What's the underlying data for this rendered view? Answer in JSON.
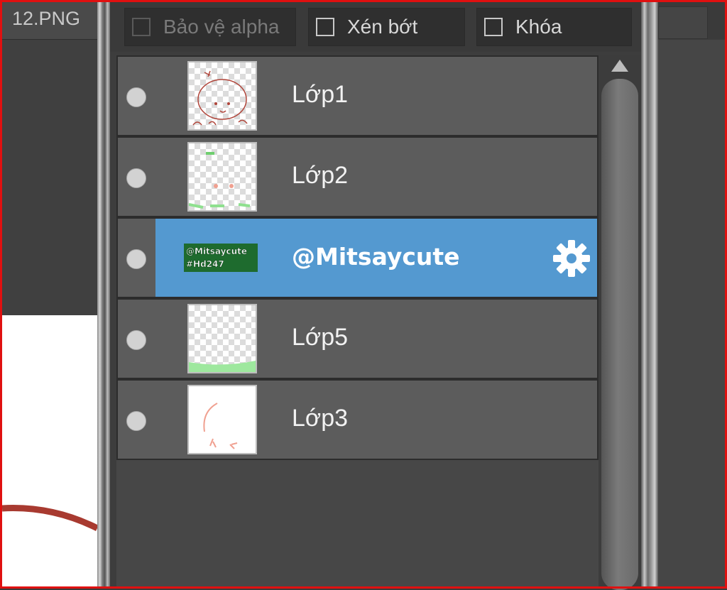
{
  "document_tab": {
    "label": "12.PNG"
  },
  "options": {
    "protect_alpha": {
      "label": "Bảo vệ alpha",
      "checked": false,
      "enabled": false
    },
    "clipping": {
      "label": "Xén bớt",
      "checked": false,
      "enabled": true
    },
    "lock": {
      "label": "Khóa",
      "checked": false,
      "enabled": true
    }
  },
  "layers": [
    {
      "name": "Lớp1",
      "visible": true,
      "selected": false
    },
    {
      "name": "Lớp2",
      "visible": true,
      "selected": false
    },
    {
      "name": "@Mitsaycute",
      "visible": true,
      "selected": true,
      "thumb_text": [
        "@Mitsaycute",
        "#Hd247"
      ]
    },
    {
      "name": "Lớp5",
      "visible": true,
      "selected": false
    },
    {
      "name": "Lớp3",
      "visible": true,
      "selected": false
    }
  ],
  "icons": {
    "gear": "gear-icon",
    "visibility": "visibility-dot-icon",
    "scroll_up": "scroll-up-arrow-icon"
  },
  "colors": {
    "selected_row": "#5499d0",
    "row": "#5c5c5c",
    "frame": "#e01010"
  }
}
